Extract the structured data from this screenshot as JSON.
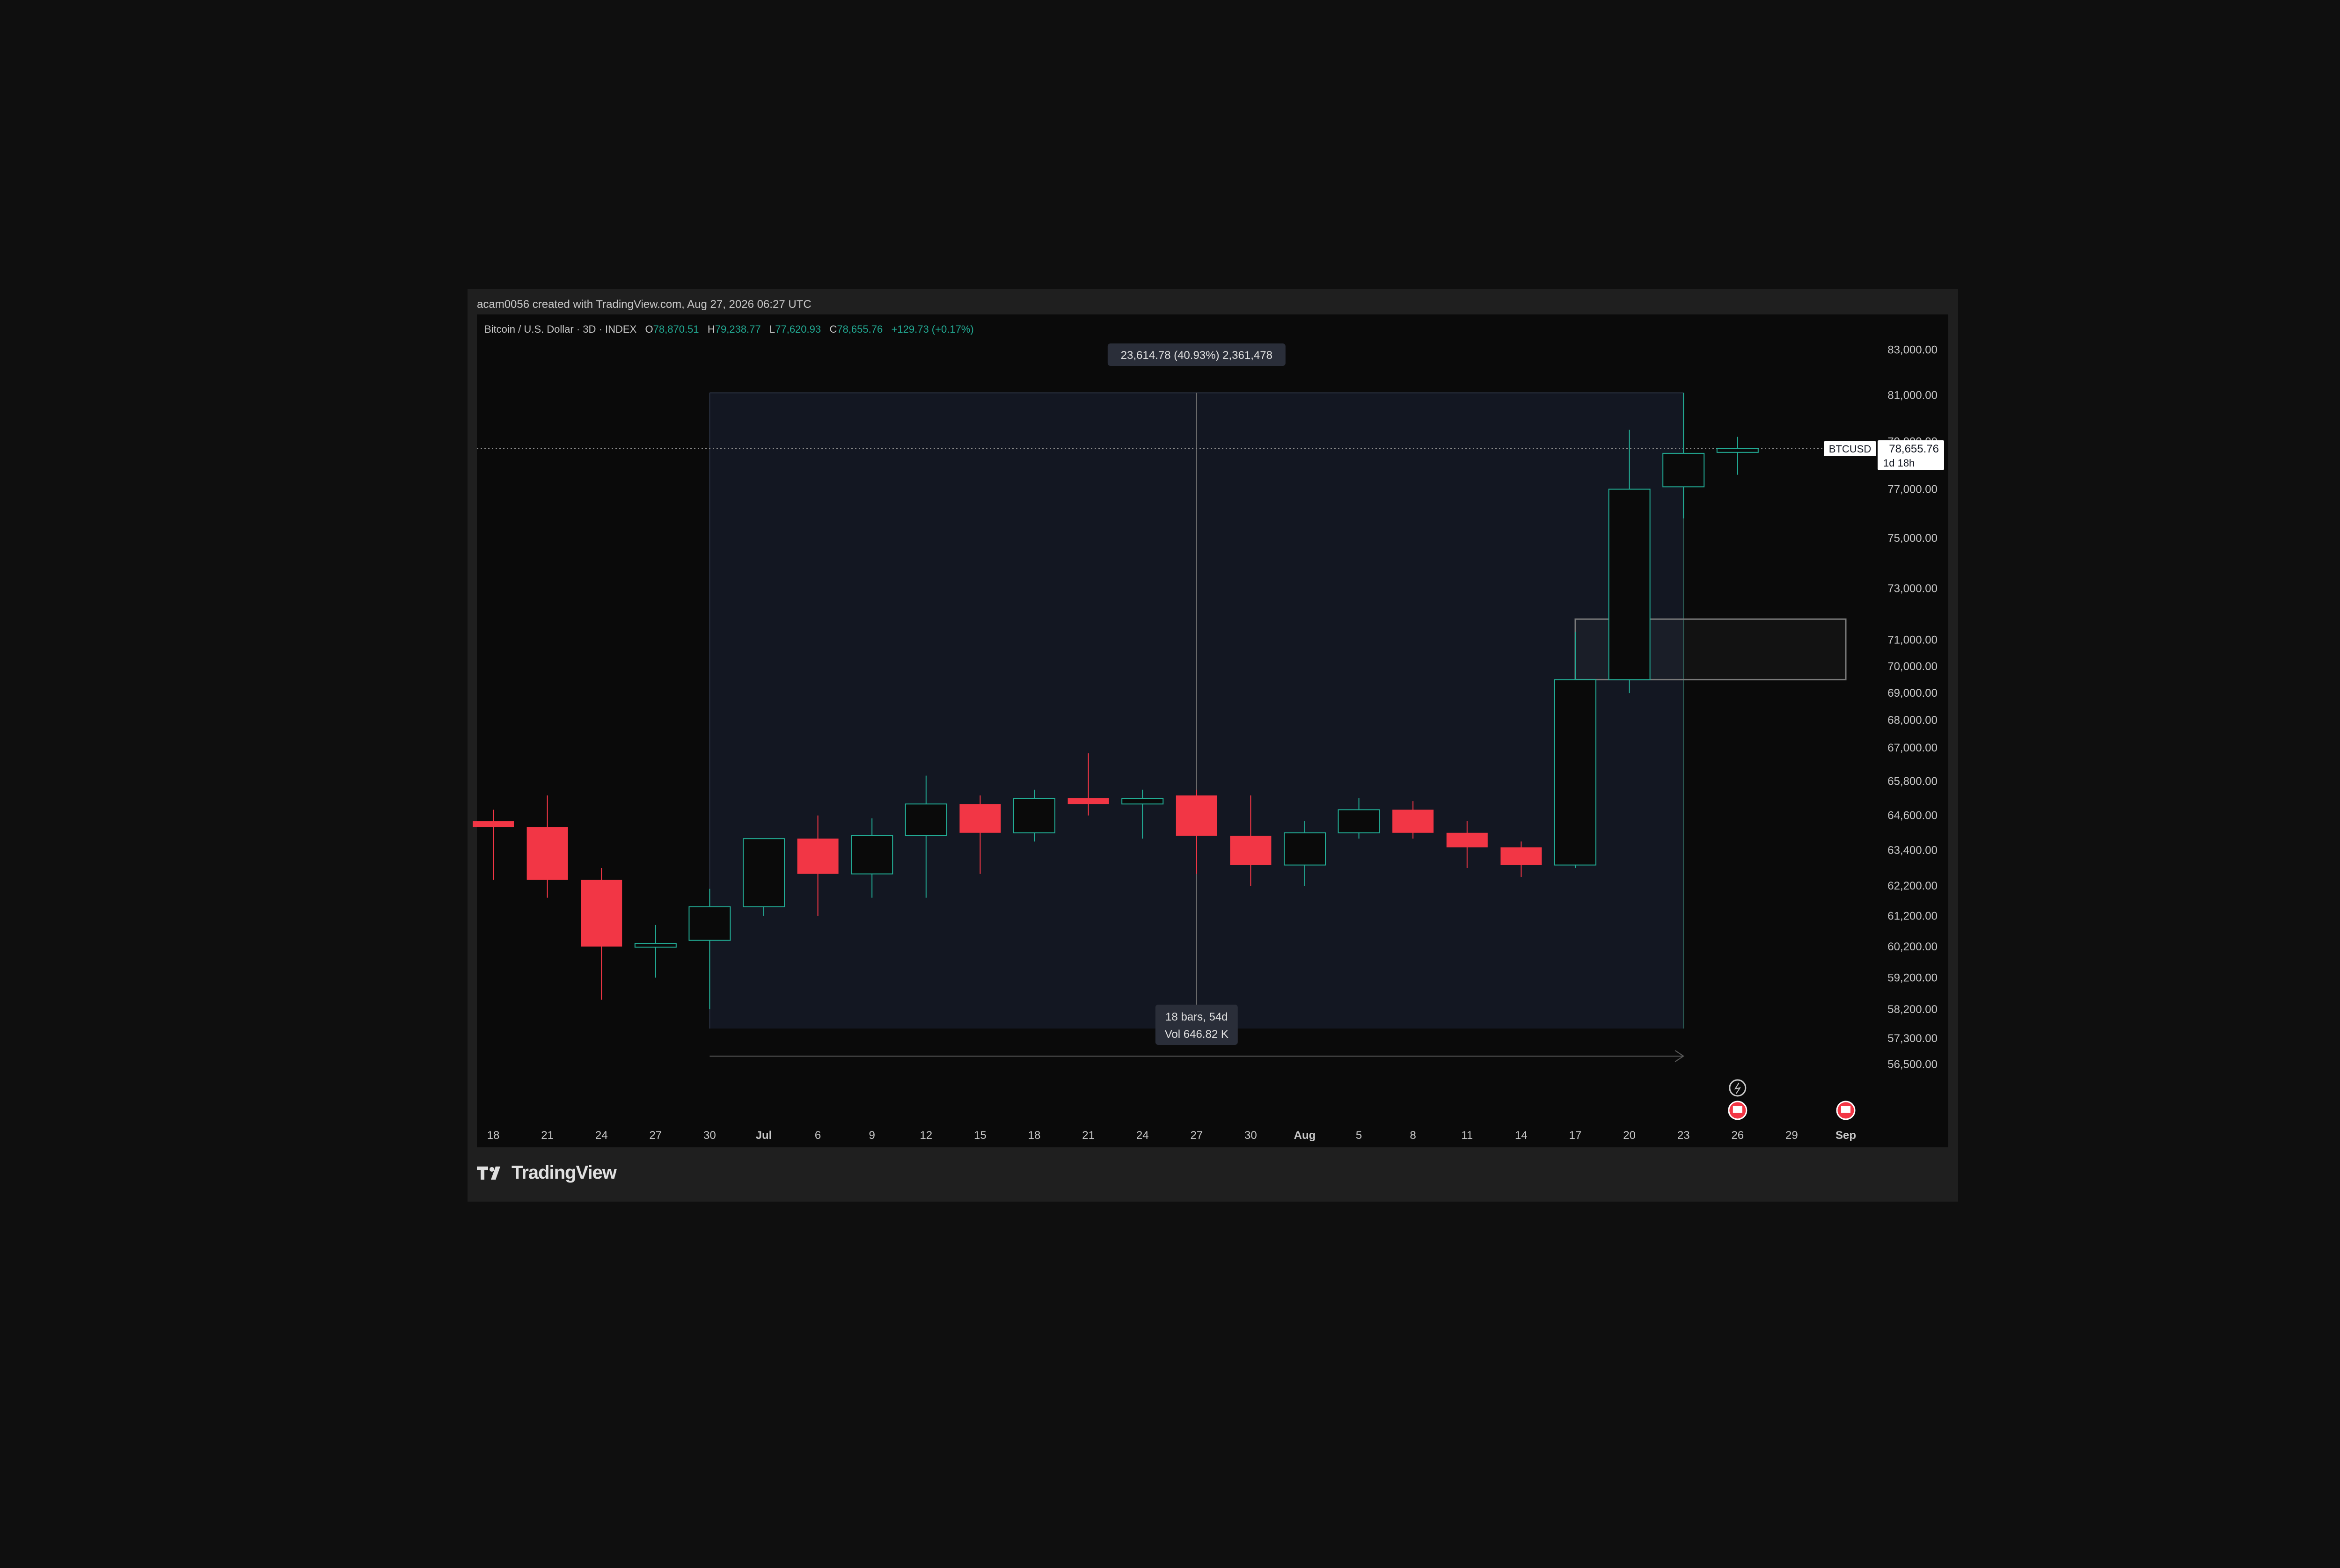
{
  "header": {
    "attribution": "acam0056 created with TradingView.com, Aug 27, 2026 06:27 UTC"
  },
  "legend": {
    "symbol": "Bitcoin / U.S. Dollar · 3D · INDEX",
    "open_label": "O",
    "open": "78,870.51",
    "high_label": "H",
    "high": "79,238.77",
    "low_label": "L",
    "low": "77,620.93",
    "close_label": "C",
    "close": "78,655.76",
    "change": "+129.73 (+0.17%)"
  },
  "footer": {
    "brand": "TradingView"
  },
  "colors": {
    "up": "#22ab94",
    "down": "#f23645",
    "background": "#0a0a0a",
    "frame": "#1f1f1f",
    "range_fill": "#131722",
    "text": "#d1d4dc"
  },
  "icons": [
    "tradingview-logo-icon",
    "dividend-icon",
    "earnings-flag-icon"
  ],
  "chart_data": {
    "type": "candlestick",
    "symbol": "BTCUSD",
    "interval": "3D",
    "price_scale": "log",
    "ylim": [
      56000,
      84000
    ],
    "y_ticks": [
      "83,000.00",
      "81,000.00",
      "79,000.00",
      "77,000.00",
      "75,000.00",
      "73,000.00",
      "71,000.00",
      "70,000.00",
      "69,000.00",
      "68,000.00",
      "67,000.00",
      "65,800.00",
      "64,600.00",
      "63,400.00",
      "62,200.00",
      "61,200.00",
      "60,200.00",
      "59,200.00",
      "58,200.00",
      "57,300.00",
      "56,500.00"
    ],
    "x_ticks": [
      "18",
      "21",
      "24",
      "27",
      "30",
      "Jul",
      "6",
      "9",
      "12",
      "15",
      "18",
      "21",
      "24",
      "27",
      "30",
      "Aug",
      "5",
      "8",
      "11",
      "14",
      "17",
      "20",
      "23",
      "26",
      "29",
      "Sep"
    ],
    "x_ticks_bold": [
      "Jul",
      "Aug",
      "Sep"
    ],
    "candles": [
      {
        "date": "Jun 18",
        "open": 64400,
        "high": 64800,
        "low": 62400,
        "close": 64200
      },
      {
        "date": "Jun 21",
        "open": 64200,
        "high": 65300,
        "low": 61800,
        "close": 62400
      },
      {
        "date": "Jun 24",
        "open": 62400,
        "high": 62800,
        "low": 58500,
        "close": 60200
      },
      {
        "date": "Jun 27",
        "open": 60200,
        "high": 60900,
        "low": 59200,
        "close": 60300
      },
      {
        "date": "Jun 30",
        "open": 60400,
        "high": 62100,
        "low": 58200,
        "close": 61500
      },
      {
        "date": "Jul 3",
        "open": 61500,
        "high": 63800,
        "low": 61200,
        "close": 63800
      },
      {
        "date": "Jul 6",
        "open": 63800,
        "high": 64600,
        "low": 61200,
        "close": 62600
      },
      {
        "date": "Jul 9",
        "open": 62600,
        "high": 64500,
        "low": 61800,
        "close": 63900
      },
      {
        "date": "Jul 12",
        "open": 63900,
        "high": 66000,
        "low": 61800,
        "close": 65000
      },
      {
        "date": "Jul 15",
        "open": 65000,
        "high": 65300,
        "low": 62600,
        "close": 64000
      },
      {
        "date": "Jul 18",
        "open": 64000,
        "high": 65500,
        "low": 63700,
        "close": 65200
      },
      {
        "date": "Jul 21",
        "open": 65200,
        "high": 66800,
        "low": 64600,
        "close": 65000
      },
      {
        "date": "Jul 24",
        "open": 65000,
        "high": 65500,
        "low": 63800,
        "close": 65200
      },
      {
        "date": "Jul 27",
        "open": 65300,
        "high": 65500,
        "low": 62600,
        "close": 63900
      },
      {
        "date": "Jul 30",
        "open": 63900,
        "high": 65300,
        "low": 62200,
        "close": 62900
      },
      {
        "date": "Aug 2",
        "open": 62900,
        "high": 64400,
        "low": 62200,
        "close": 64000
      },
      {
        "date": "Aug 5",
        "open": 64000,
        "high": 65200,
        "low": 63800,
        "close": 64800
      },
      {
        "date": "Aug 8",
        "open": 64800,
        "high": 65100,
        "low": 63800,
        "close": 64000
      },
      {
        "date": "Aug 11",
        "open": 64000,
        "high": 64400,
        "low": 62800,
        "close": 63500
      },
      {
        "date": "Aug 14",
        "open": 63500,
        "high": 63700,
        "low": 62500,
        "close": 62900
      },
      {
        "date": "Aug 17",
        "open": 62900,
        "high": 71300,
        "low": 62800,
        "close": 69500
      },
      {
        "date": "Aug 20",
        "open": 69500,
        "high": 79500,
        "low": 69000,
        "close": 77000
      },
      {
        "date": "Aug 23",
        "open": 77100,
        "high": 81100,
        "low": 75800,
        "close": 78500
      },
      {
        "date": "Aug 26",
        "open": 78600,
        "high": 79200,
        "low": 77600,
        "close": 78700
      }
    ],
    "price_line": {
      "label": "BTCUSD",
      "value": "78,655.76",
      "countdown": "1d 18h"
    },
    "range_measure": {
      "from_date": "Jun 30",
      "to_date": "Aug 23",
      "top_price": 81100,
      "bottom_price": 57600,
      "change_label": "23,614.78 (40.93%) 2,361,478",
      "bars_label": "18 bars, 54d",
      "volume_label": "Vol 646.82 K"
    },
    "rectangle": {
      "from_date": "Aug 17",
      "to_date": "Sep 1",
      "top_price": 71800,
      "bottom_price": 69500
    },
    "events": [
      {
        "date": "Aug 26",
        "type": "dividend"
      },
      {
        "date": "Aug 26",
        "type": "earnings"
      },
      {
        "date": "Sep 1",
        "type": "earnings"
      }
    ]
  }
}
